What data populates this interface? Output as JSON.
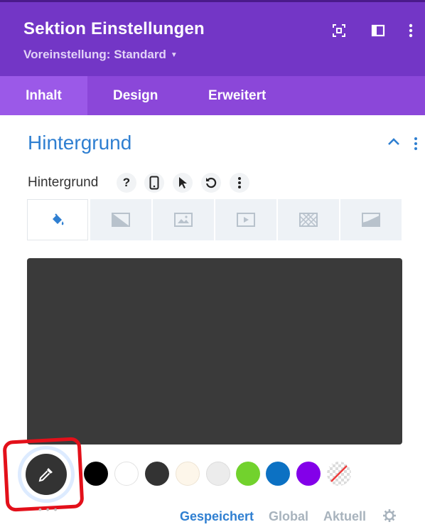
{
  "header": {
    "title": "Sektion Einstellungen",
    "preset_label": "Voreinstellung: Standard",
    "icons": [
      "focus-frame-icon",
      "sidebar-layout-icon",
      "more-vert-icon"
    ],
    "background_color": "#7336c6"
  },
  "tabs": [
    {
      "label": "Inhalt",
      "active": true
    },
    {
      "label": "Design",
      "active": false
    },
    {
      "label": "Erweitert",
      "active": false
    }
  ],
  "section": {
    "title": "Hintergrund",
    "expanded": true
  },
  "field": {
    "label": "Hintergrund",
    "tools": [
      "help-icon",
      "mobile-icon",
      "cursor-icon",
      "reset-icon",
      "more-vert-icon"
    ]
  },
  "background_types": [
    {
      "icon": "paint-bucket-icon",
      "active": true
    },
    {
      "icon": "gradient-icon",
      "active": false
    },
    {
      "icon": "image-icon",
      "active": false
    },
    {
      "icon": "video-icon",
      "active": false
    },
    {
      "icon": "pattern-icon",
      "active": false
    },
    {
      "icon": "mask-icon",
      "active": false
    }
  ],
  "preview": {
    "color": "#3a3a3a"
  },
  "swatches": [
    {
      "color": "#000000"
    },
    {
      "color": "#ffffff"
    },
    {
      "color": "#333333"
    },
    {
      "color": "#fdf6ea"
    },
    {
      "color": "#ececec"
    },
    {
      "color": "#72d22d"
    },
    {
      "color": "#0c71c3"
    },
    {
      "color": "#8300e9"
    },
    {
      "color": "transparent"
    }
  ],
  "palette_tabs": [
    {
      "label": "Gespeichert",
      "color": "#2f7fd1"
    },
    {
      "label": "Global",
      "color": "#a8b3bd"
    },
    {
      "label": "Aktuell",
      "color": "#a8b3bd"
    }
  ],
  "annotation_color": "#e3101a"
}
